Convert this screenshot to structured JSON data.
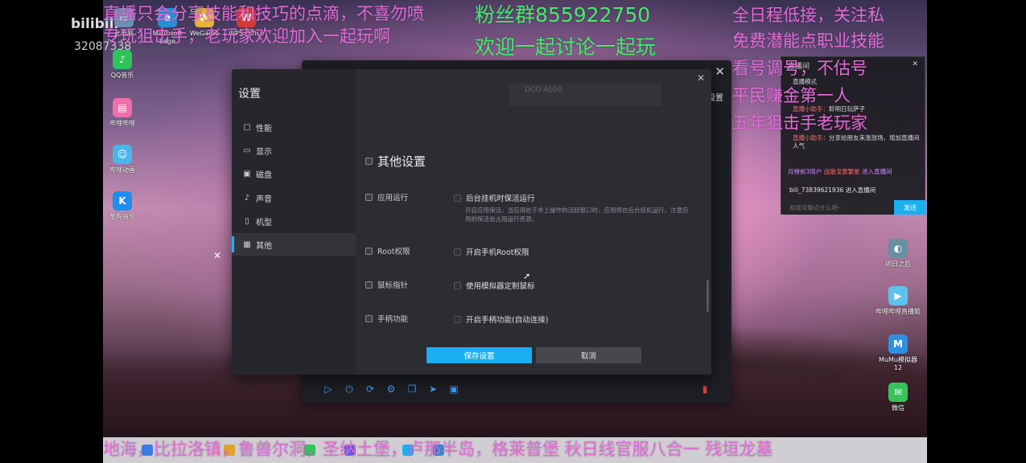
{
  "stream": {
    "platform_logo": "bilibili",
    "user_id": "32087338",
    "top_left_lines": [
      "直播只会分享技能和技巧的点滴，不喜勿喷",
      "专玩狙击手，老玩家欢迎加入一起玩啊"
    ],
    "top_center_lines": [
      "粉丝群855922750",
      "欢迎一起讨论一起玩"
    ],
    "top_right_lines": [
      "全日程低接，关注私",
      "免费潜能点职业技能",
      "看号调号，不估号",
      "平民赚金第一人",
      "五年狙击手老玩家"
    ],
    "bottom_ticker": "地海，比拉洛镇，鲁兽尔洞，圣纳土堡，卢那半岛，格莱普堡   秋日线官服八合一 残垣龙墓"
  },
  "desktop": {
    "left_icons": [
      {
        "name": "qq-music-icon",
        "label": "QQ音乐",
        "color": "#2ec35b"
      },
      {
        "name": "tools-icon",
        "label": "哔哩哔哩",
        "color": "#f06ea9"
      },
      {
        "name": "anime-icon",
        "label": "哔哩动画",
        "color": "#47b6e8"
      },
      {
        "name": "kugou-icon",
        "label": "酷狗音乐",
        "color": "#1f8ef0"
      }
    ],
    "top_icons": [
      {
        "name": "computer-icon",
        "label": "此电脑"
      },
      {
        "name": "edge-icon",
        "label": "Microsoft Edge"
      },
      {
        "name": "wegame-icon",
        "label": "WeGame"
      },
      {
        "name": "wps-icon",
        "label": "WPS Office"
      }
    ],
    "right_icons": [
      {
        "name": "tomorrow-icon",
        "label": "明日之后",
        "color": "#6a8fa0"
      },
      {
        "name": "live-tool-icon",
        "label": "哔哩哔哩直播姬",
        "color": "#5dc2f0"
      },
      {
        "name": "mumu-icon",
        "label": "MuMu模拟器12",
        "color": "#2f8fe0"
      },
      {
        "name": "wechat-icon",
        "label": "微信",
        "color": "#39c35a"
      }
    ]
  },
  "emulator": {
    "side_label": "设置",
    "close_glyph": "✕"
  },
  "settings": {
    "title": "设置",
    "close_glyph": "✕",
    "nav": [
      {
        "label": "性能",
        "icon": "cpu-icon",
        "glyph": "▢",
        "active": false
      },
      {
        "label": "显示",
        "icon": "display-icon",
        "glyph": "▭",
        "active": false
      },
      {
        "label": "磁盘",
        "icon": "disk-icon",
        "glyph": "▣",
        "active": false
      },
      {
        "label": "声音",
        "icon": "sound-icon",
        "glyph": "♪",
        "active": false
      },
      {
        "label": "机型",
        "icon": "phone-icon",
        "glyph": "▯",
        "active": false
      },
      {
        "label": "其他",
        "icon": "grid-icon",
        "glyph": "▦",
        "active": true
      }
    ],
    "model_value": "DCO-AL00",
    "section_title": "其他设置",
    "rows": [
      {
        "label": "应用运行",
        "option": "后台挂机时保活运行",
        "desc": "开启应用保活，当应用处于非上操作的活跃窗口时，应用将在后台挂机运行，注意应用的保活会占用运行资源。"
      },
      {
        "label": "Root权限",
        "option": "开启手机Root权限"
      },
      {
        "label": "鼠标指针",
        "option": "使用模拟器定制鼠标"
      },
      {
        "label": "手柄功能",
        "option": "开启手柄功能(自动连接)"
      }
    ],
    "save_label": "保存设置",
    "cancel_label": "取消"
  },
  "chat": {
    "header": "直播间",
    "messages": [
      {
        "who": "",
        "text": "直播模式"
      },
      {
        "who": "直播小助手：",
        "text": "聆明日玩萨子"
      },
      {
        "who": "直播小助手：",
        "text": "分享给朋友来涨涨场，增加直播间人气"
      }
    ],
    "system_prefix": "月榜前3用户",
    "system_highlight": "战狼戈墨繁星",
    "system_suffix": "进入直播间",
    "join_text": "bili_73839621936 进入直播间",
    "input_placeholder": "和观众聊点什么吧~",
    "send_label": "发送"
  },
  "colors": {
    "accent": "#1ab0f0",
    "overlay_pink": "#e36bd9",
    "overlay_green": "#40ee6a"
  }
}
